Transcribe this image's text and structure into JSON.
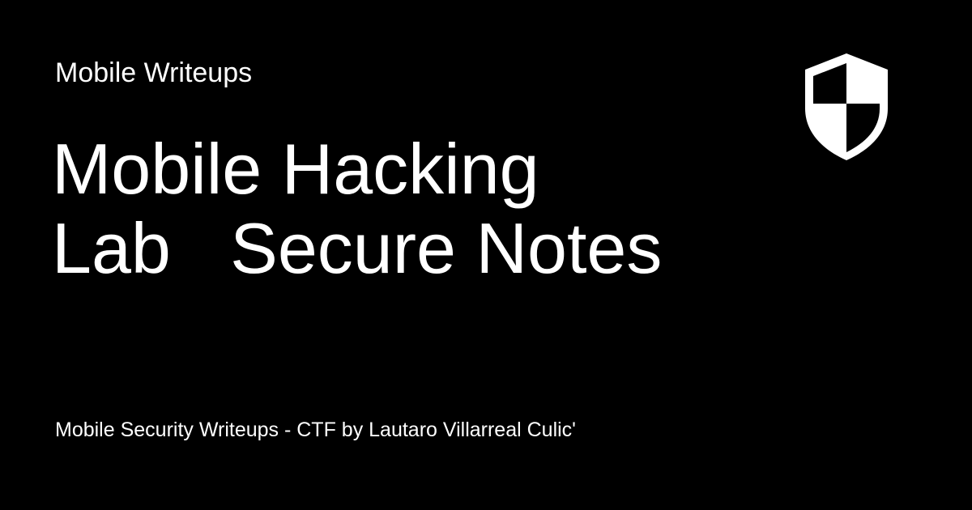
{
  "section_label": "Mobile Writeups",
  "title_line_1": "Mobile Hacking",
  "title_line_2": "Lab   Secure Notes",
  "footer_text": "Mobile Security Writeups - CTF by Lautaro Villarreal Culic'",
  "logo_icon": "shield-icon",
  "colors": {
    "background": "#000000",
    "text": "#ffffff"
  }
}
